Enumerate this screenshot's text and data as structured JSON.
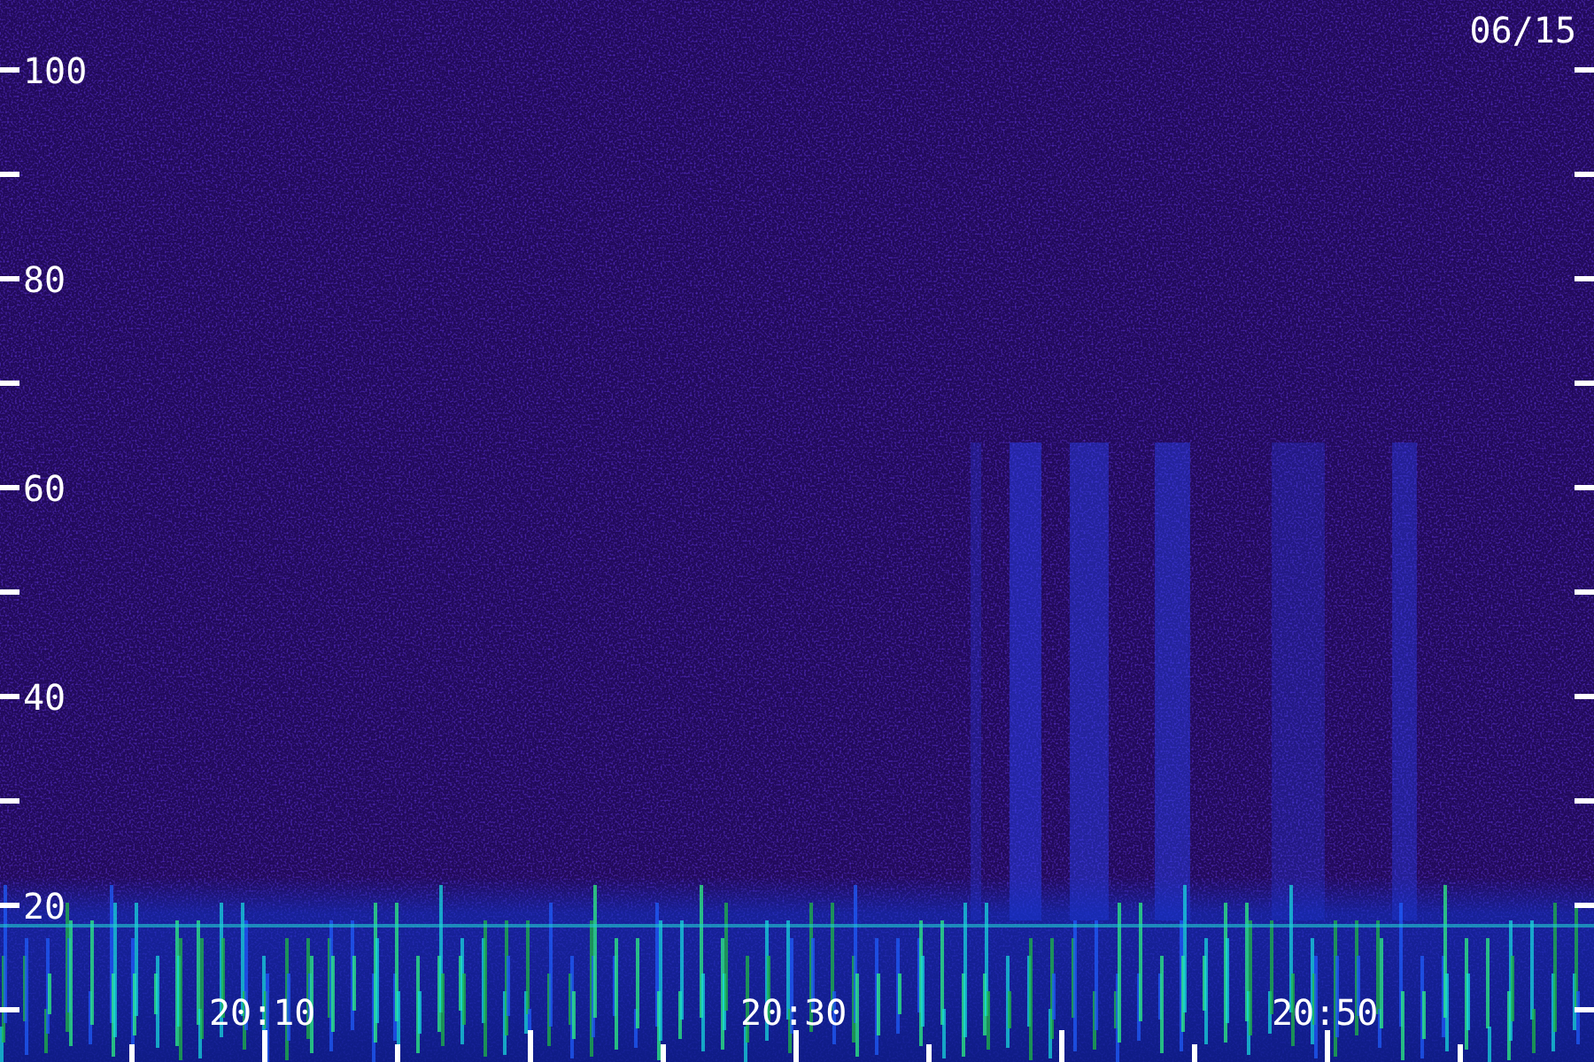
{
  "date": "06/15",
  "y_axis": {
    "labels": [
      "100",
      "80",
      "60",
      "40",
      "20"
    ]
  },
  "x_axis": {
    "labels": [
      "20:10",
      "20:30",
      "20:50"
    ]
  }
}
